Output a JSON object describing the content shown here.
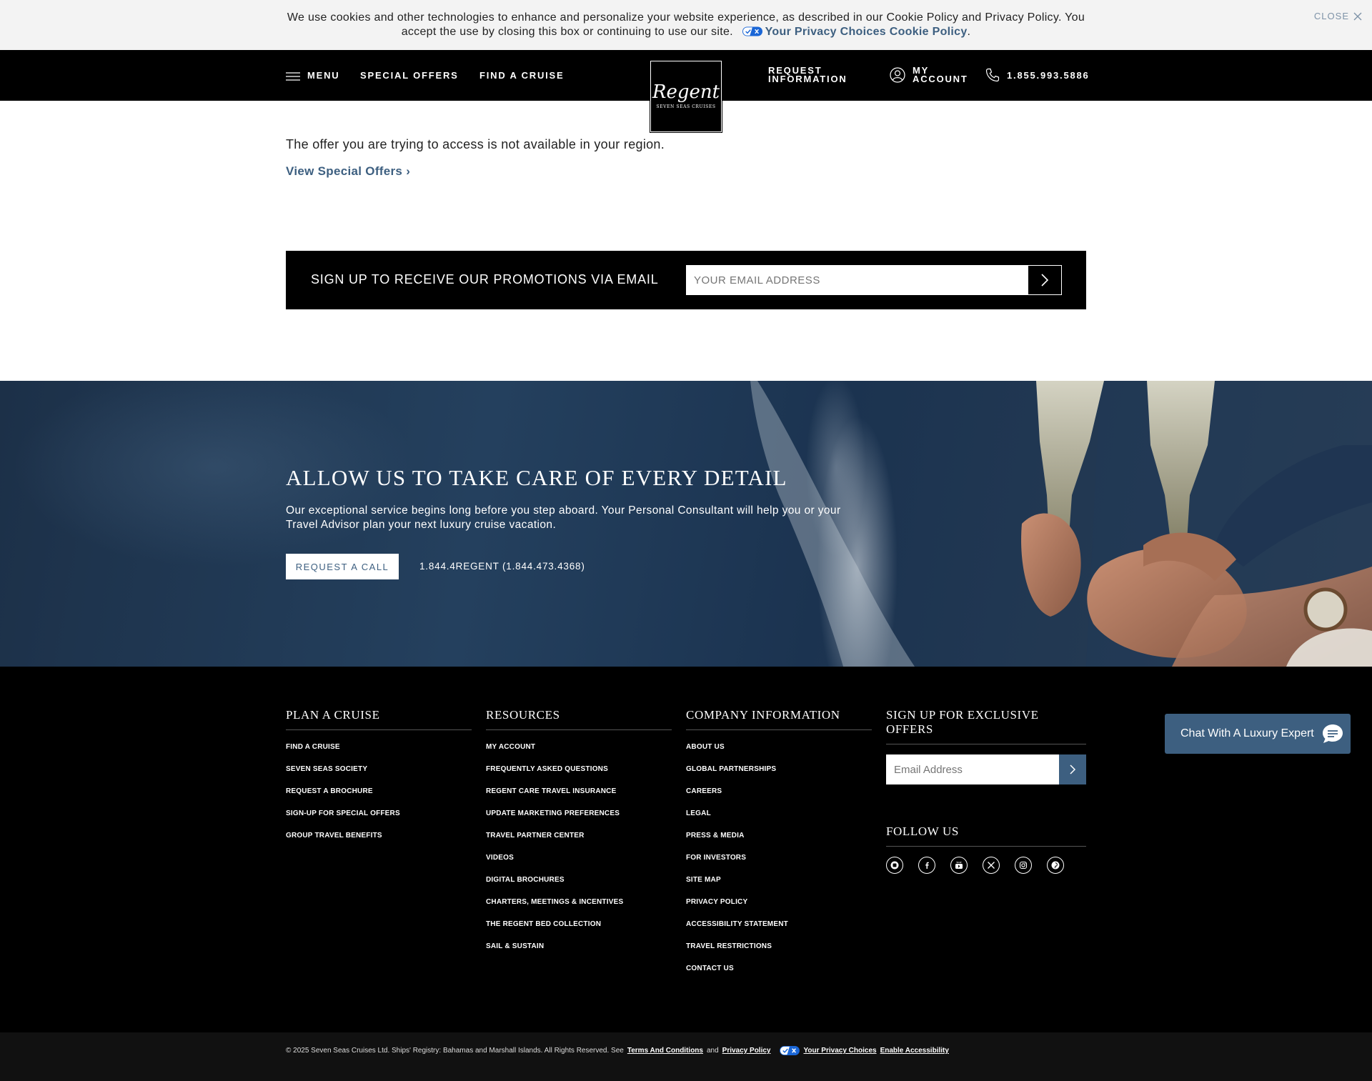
{
  "cookie_banner": {
    "text": "We use cookies and other technologies to enhance and personalize your website experience, as described in our Cookie Policy and Privacy Policy. You accept the use by closing this box or continuing to use our site.",
    "privacy_link": "Your Privacy Choices",
    "cookie_link": "Cookie Policy",
    "period": ".",
    "close_label": "CLOSE"
  },
  "header": {
    "menu_label": "MENU",
    "special_offers": "SPECIAL OFFERS",
    "find_cruise": "FIND A CRUISE",
    "logo_script": "Regent",
    "logo_sub": "SEVEN SEAS CRUISES",
    "request_info_1": "REQUEST",
    "request_info_2": "INFORMATION",
    "account_1": "MY",
    "account_2": "ACCOUNT",
    "phone": "1.855.993.5886"
  },
  "main": {
    "message": "The offer you are trying to access is not available in your region.",
    "view_link": "View Special Offers ›"
  },
  "signup": {
    "label": "SIGN UP TO RECEIVE OUR PROMOTIONS VIA EMAIL",
    "placeholder": "YOUR EMAIL ADDRESS"
  },
  "hero": {
    "title": "ALLOW US TO TAKE CARE OF EVERY DETAIL",
    "description": "Our exceptional service begins long before you step aboard. Your Personal Consultant will help you or your Travel Advisor plan your next luxury cruise vacation.",
    "button": "REQUEST A CALL",
    "phone": "1.844.4REGENT (1.844.473.4368)"
  },
  "footer": {
    "plan": {
      "title": "PLAN A CRUISE",
      "items": [
        "FIND A CRUISE",
        "SEVEN SEAS SOCIETY",
        "REQUEST A BROCHURE",
        "SIGN-UP FOR SPECIAL OFFERS",
        "GROUP TRAVEL BENEFITS"
      ]
    },
    "resources": {
      "title": "RESOURCES",
      "items": [
        "MY ACCOUNT",
        "FREQUENTLY ASKED QUESTIONS",
        "REGENT CARE TRAVEL INSURANCE",
        "UPDATE MARKETING PREFERENCES",
        "TRAVEL PARTNER CENTER",
        "VIDEOS",
        "DIGITAL BROCHURES",
        "CHARTERS, MEETINGS & INCENTIVES",
        "THE REGENT BED COLLECTION",
        "SAIL & SUSTAIN"
      ]
    },
    "company": {
      "title": "COMPANY INFORMATION",
      "items": [
        "ABOUT US",
        "GLOBAL PARTNERSHIPS",
        "CAREERS",
        "LEGAL",
        "PRESS & MEDIA",
        "FOR INVESTORS",
        "SITE MAP",
        "PRIVACY POLICY",
        "ACCESSIBILITY STATEMENT",
        "TRAVEL RESTRICTIONS",
        "CONTACT US"
      ]
    },
    "offers": {
      "title": "SIGN UP FOR EXCLUSIVE OFFERS",
      "placeholder": "Email Address",
      "follow_title": "FOLLOW US",
      "social_icons": [
        "blog-icon",
        "facebook-icon",
        "youtube-icon",
        "x-icon",
        "instagram-icon",
        "pinterest-icon"
      ]
    }
  },
  "chat": {
    "label": "Chat With A Luxury Expert"
  },
  "legal": {
    "copyright": "© 2025 Seven Seas Cruises Ltd. Ships' Registry: Bahamas and Marshall Islands. All Rights Reserved. See",
    "terms": "Terms And Conditions",
    "and": "and",
    "privacy": "Privacy Policy",
    "choices": "Your Privacy Choices",
    "accessibility": "Enable Accessibility"
  },
  "colors": {
    "accent": "#3d5f80",
    "header_bg": "#000000",
    "cookie_bg": "#f3f3f3"
  }
}
